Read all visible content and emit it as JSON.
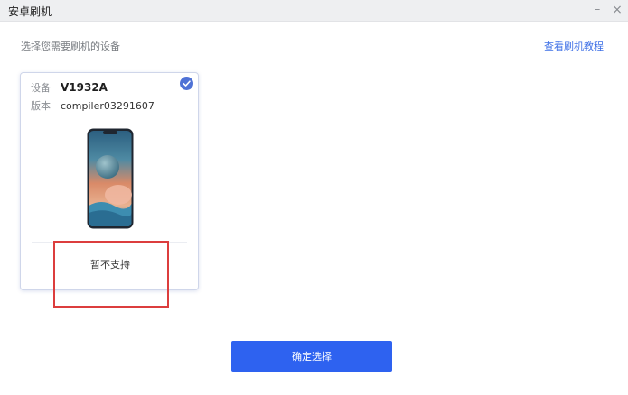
{
  "window": {
    "title": "安卓刷机",
    "minimize_glyph": "–",
    "close_glyph": "×"
  },
  "header": {
    "prompt": "选择您需要刷机的设备",
    "tutorial_link": "查看刷机教程"
  },
  "device_card": {
    "device_label": "设备",
    "device_value": "V1932A",
    "version_label": "版本",
    "version_value": "compiler03291607",
    "status": "暂不支持",
    "selected": true,
    "check_icon": "check-circle-icon"
  },
  "footer": {
    "confirm_label": "确定选择"
  },
  "colors": {
    "accent": "#2e62f0",
    "link": "#3d6fe6",
    "highlight": "#dc3d3d",
    "titlebar": "#eeeff1"
  }
}
